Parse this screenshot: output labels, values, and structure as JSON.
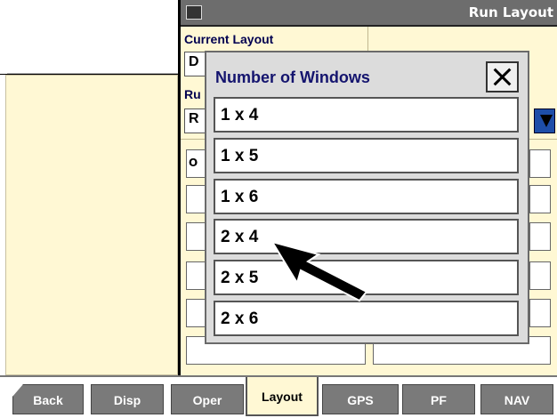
{
  "window": {
    "title": "Run Layout"
  },
  "layout_form": {
    "current_layout_label": "Current Layout",
    "current_layout_value": "D",
    "run_label": "Ru",
    "run_value": "R",
    "option_partial": "O"
  },
  "modal": {
    "title": "Number of Windows",
    "options": [
      "1 x 4",
      "1 x 5",
      "1 x 6",
      "2 x 4",
      "2 x 5",
      "2 x 6"
    ]
  },
  "bottom_tabs": [
    "Back",
    "Disp",
    "Oper",
    "Layout",
    "GPS",
    "PF",
    "NAV"
  ],
  "active_tab": "Layout",
  "icons": {
    "close": "close-icon",
    "dropdown": "dropdown-arrow-icon",
    "pointer": "pointer-arrow-icon",
    "window_icon": "display-icon"
  }
}
